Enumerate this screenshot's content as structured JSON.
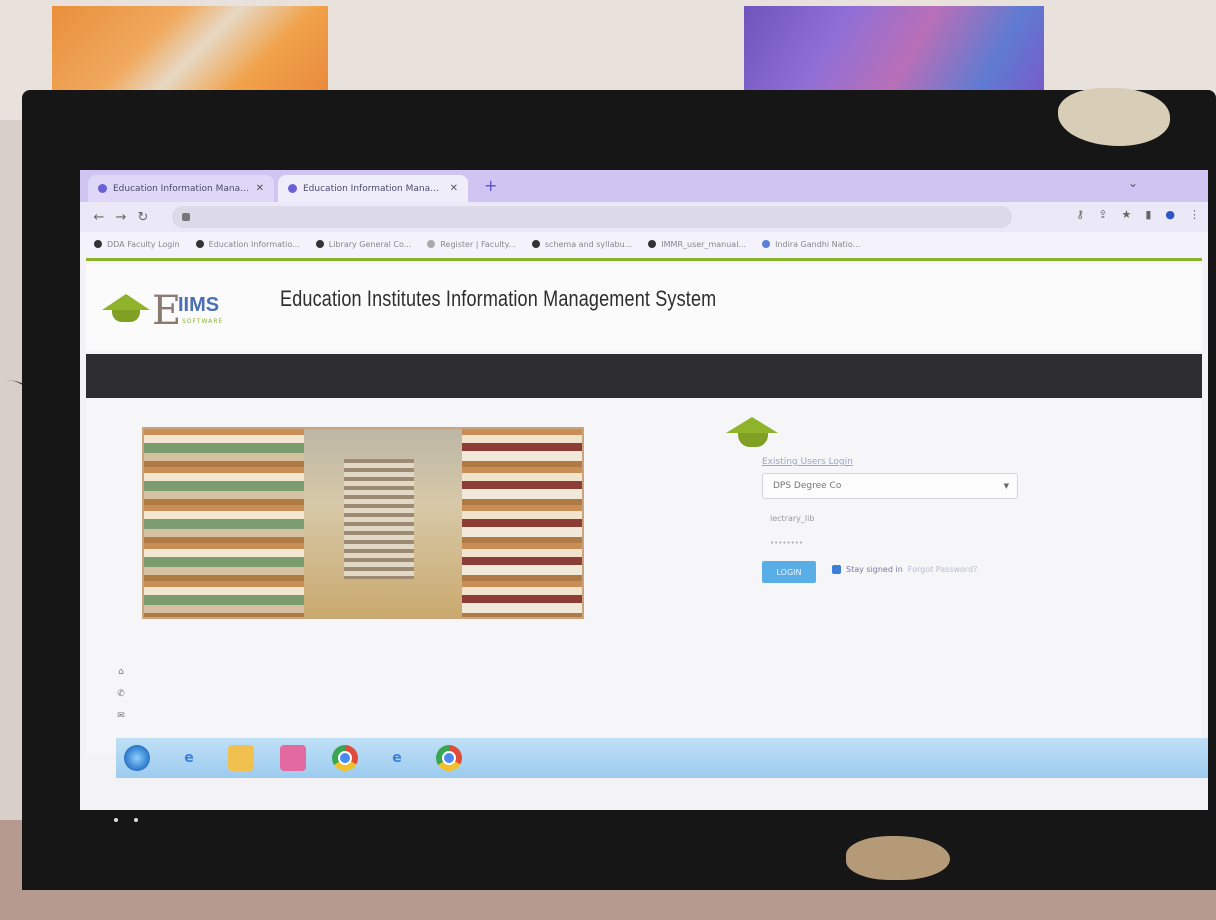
{
  "browser": {
    "tabs": [
      {
        "label": "Education Information Manage...",
        "active": false
      },
      {
        "label": "Education Information Manage...",
        "active": true
      }
    ],
    "new_tab_icon": "plus-icon",
    "bookmarks": [
      {
        "label": "DDA Faculty Login"
      },
      {
        "label": "Education Informatio..."
      },
      {
        "label": "Library General Co..."
      },
      {
        "label": "Register | Faculty..."
      },
      {
        "label": "schema and syllabu..."
      },
      {
        "label": "IMMR_user_manual..."
      },
      {
        "label": "Indira Gandhi Natio..."
      }
    ]
  },
  "site": {
    "logo_letter": "E",
    "logo_text": "IIMS",
    "logo_subtitle": "SOFTWARE",
    "title": "Education Institutes Information Management System",
    "accent_color": "#8bb32b",
    "navbar_color": "#2d2d2f"
  },
  "login": {
    "heading": "Existing Users Login",
    "institute_value": "DPS Degree Co",
    "username_value": "lectrary_lib",
    "password_value": "••••••••",
    "login_label": "LOGIN",
    "remember_label": "Stay signed in",
    "forgot_label": "Forgot Password?",
    "button_color": "#5aaee8"
  },
  "taskbar": {
    "items": [
      "start-orb",
      "ie-icon",
      "folder-icon",
      "media-icon",
      "chrome-icon",
      "chrome-icon"
    ]
  }
}
